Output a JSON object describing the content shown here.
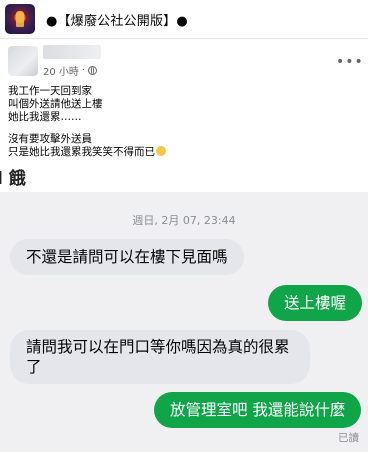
{
  "group": {
    "name": "●【爆廢公社公開版】●"
  },
  "post": {
    "time": "20 小時",
    "separator": "·",
    "lines": [
      "我工作一天回到家",
      "叫個外送請他送上樓",
      "她比我還累……",
      "",
      "沒有要攻擊外送員",
      "只是她比我還累我笑笑不得而已"
    ],
    "emoji_icon": "tired-face-emoji"
  },
  "chat": {
    "title_fragment": "l 餓",
    "timestamp": "週日, 2月 07, 23:44",
    "messages": [
      {
        "side": "in",
        "text": "不還是請問可以在樓下見面嗎"
      },
      {
        "side": "out",
        "text": "送上樓喔"
      },
      {
        "side": "in",
        "text": "請問我可以在門口等你嗎因為真的很累了"
      },
      {
        "side": "out",
        "text": "放管理室吧 我還能說什麼"
      }
    ],
    "read_status": "已讀"
  },
  "colors": {
    "outgoing_bubble": "#11a54a",
    "incoming_bubble": "#e4e6eb",
    "chat_background": "#f0f0f2"
  }
}
